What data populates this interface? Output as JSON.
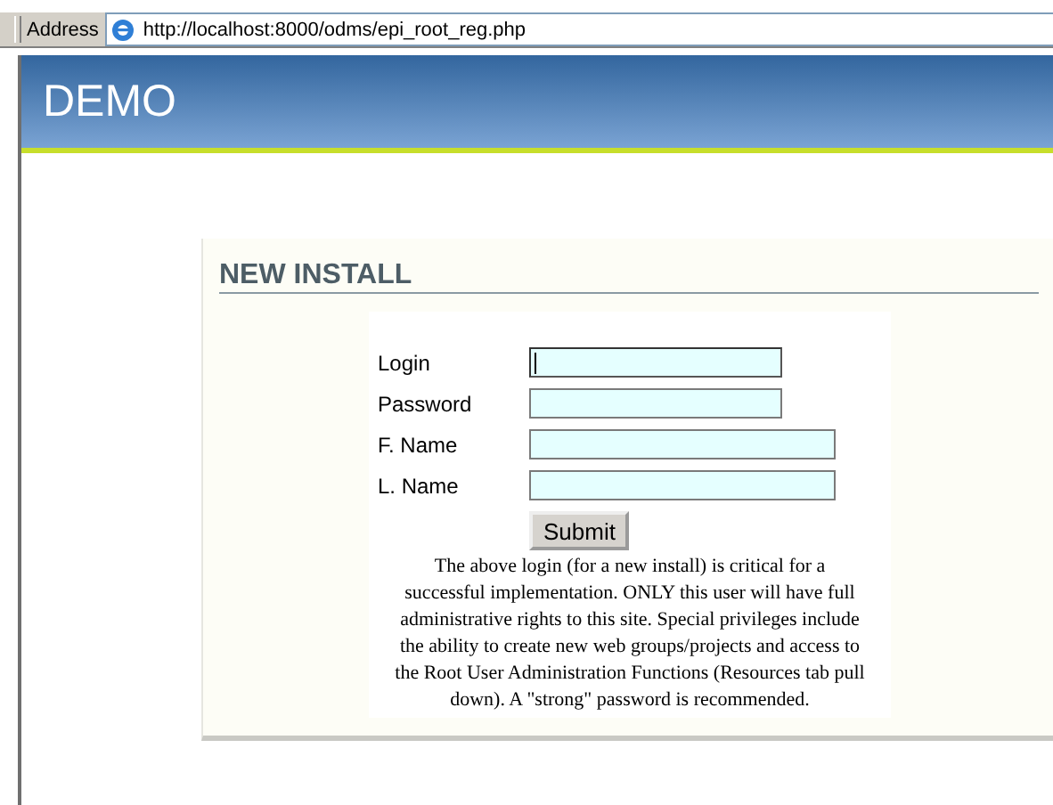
{
  "address_bar": {
    "label": "Address",
    "url": "http://localhost:8000/odms/epi_root_reg.php"
  },
  "header": {
    "title": "DEMO"
  },
  "panel": {
    "heading": "NEW INSTALL",
    "fields": [
      {
        "label": "Login",
        "kind": "short",
        "focused": true
      },
      {
        "label": "Password",
        "kind": "short",
        "focused": false
      },
      {
        "label": "F. Name",
        "kind": "long",
        "focused": false
      },
      {
        "label": "L. Name",
        "kind": "long",
        "focused": false
      }
    ],
    "submit": "Submit",
    "note": "The above login (for a new install) is critical for a successful implementation. ONLY this user will have full administrative rights to this site. Special privileges include the ability to create new web groups/projects and access to the Root User Administration Functions (Resources tab pull down). A \"strong\" password is recommended."
  }
}
